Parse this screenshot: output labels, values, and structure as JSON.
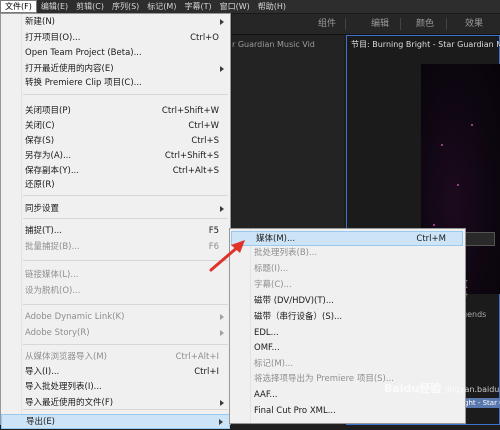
{
  "menubar": {
    "items": [
      "文件(F)",
      "编辑(E)",
      "剪辑(C)",
      "序列(S)",
      "标记(M)",
      "字幕(T)",
      "窗口(W)",
      "帮助(H)"
    ]
  },
  "workspaces": {
    "tabs": [
      "组件",
      "编辑",
      "颜色",
      "效果"
    ]
  },
  "source_panel": {
    "title": "r Guardian Music Vid"
  },
  "program_panel": {
    "title": "节目: Burning Bright - Star Guardian Music Vi"
  },
  "timeline": {
    "label_fragment": "gends",
    "clip_label": "ght - Star G"
  },
  "file_menu": {
    "items": [
      {
        "label": "新建(N)",
        "shortcut": "",
        "submenu": true,
        "disabled": false
      },
      {
        "label": "打开项目(O)...",
        "shortcut": "Ctrl+O",
        "submenu": false,
        "disabled": false
      },
      {
        "label": "Open Team Project (Beta)...",
        "shortcut": "",
        "submenu": false,
        "disabled": false
      },
      {
        "label": "打开最近使用的内容(E)",
        "shortcut": "",
        "submenu": true,
        "disabled": false
      },
      {
        "label": "转换 Premiere Clip 项目(C)...",
        "shortcut": "",
        "submenu": false,
        "disabled": false
      },
      {
        "label": "关闭项目(P)",
        "shortcut": "Ctrl+Shift+W",
        "submenu": false,
        "disabled": false
      },
      {
        "label": "关闭(C)",
        "shortcut": "Ctrl+W",
        "submenu": false,
        "disabled": false
      },
      {
        "label": "保存(S)",
        "shortcut": "Ctrl+S",
        "submenu": false,
        "disabled": false
      },
      {
        "label": "另存为(A)...",
        "shortcut": "Ctrl+Shift+S",
        "submenu": false,
        "disabled": false
      },
      {
        "label": "保存副本(Y)...",
        "shortcut": "Ctrl+Alt+S",
        "submenu": false,
        "disabled": false
      },
      {
        "label": "还原(R)",
        "shortcut": "",
        "submenu": false,
        "disabled": false
      },
      {
        "label": "同步设置",
        "shortcut": "",
        "submenu": true,
        "disabled": false
      },
      {
        "label": "捕捉(T)...",
        "shortcut": "F5",
        "submenu": false,
        "disabled": false
      },
      {
        "label": "批量捕捉(B)...",
        "shortcut": "F6",
        "submenu": false,
        "disabled": true
      },
      {
        "label": "链接媒体(L)...",
        "shortcut": "",
        "submenu": false,
        "disabled": true
      },
      {
        "label": "设为脱机(O)...",
        "shortcut": "",
        "submenu": false,
        "disabled": true
      },
      {
        "label": "Adobe Dynamic Link(K)",
        "shortcut": "",
        "submenu": true,
        "disabled": true
      },
      {
        "label": "Adobe Story(R)",
        "shortcut": "",
        "submenu": true,
        "disabled": true
      },
      {
        "label": "从媒体浏览器导入(M)",
        "shortcut": "Ctrl+Alt+I",
        "submenu": false,
        "disabled": true
      },
      {
        "label": "导入(I)...",
        "shortcut": "Ctrl+I",
        "submenu": false,
        "disabled": false
      },
      {
        "label": "导入批处理列表(I)...",
        "shortcut": "",
        "submenu": false,
        "disabled": false
      },
      {
        "label": "导入最近使用的文件(F)",
        "shortcut": "",
        "submenu": true,
        "disabled": false
      },
      {
        "label": "导出(E)",
        "shortcut": "",
        "submenu": true,
        "disabled": false
      }
    ]
  },
  "export_menu": {
    "items": [
      {
        "label": "媒体(M)...",
        "shortcut": "Ctrl+M",
        "disabled": false
      },
      {
        "label": "批处理列表(B)...",
        "shortcut": "",
        "disabled": true
      },
      {
        "label": "标题(I)...",
        "shortcut": "",
        "disabled": true
      },
      {
        "label": "字幕(C)...",
        "shortcut": "",
        "disabled": true
      },
      {
        "label": "磁带 (DV/HDV)(T)...",
        "shortcut": "",
        "disabled": false
      },
      {
        "label": "磁带（串行设备）(S)...",
        "shortcut": "",
        "disabled": false
      },
      {
        "label": "EDL...",
        "shortcut": "",
        "disabled": false
      },
      {
        "label": "OMF...",
        "shortcut": "",
        "disabled": false
      },
      {
        "label": "标记(M)...",
        "shortcut": "",
        "disabled": true
      },
      {
        "label": "将选择项导出为 Premiere 项目(S)...",
        "shortcut": "",
        "disabled": true
      },
      {
        "label": "AAF...",
        "shortcut": "",
        "disabled": false
      },
      {
        "label": "Final Cut Pro XML...",
        "shortcut": "",
        "disabled": false
      }
    ]
  },
  "watermark": {
    "text": "Baidu经验",
    "sub": "jingyan.baidu.com"
  },
  "colors": {
    "highlight": "#cde4f7",
    "menu_bg": "#f0f0f0",
    "accent_border": "#3c72c7",
    "arrow": "#e0322b"
  }
}
